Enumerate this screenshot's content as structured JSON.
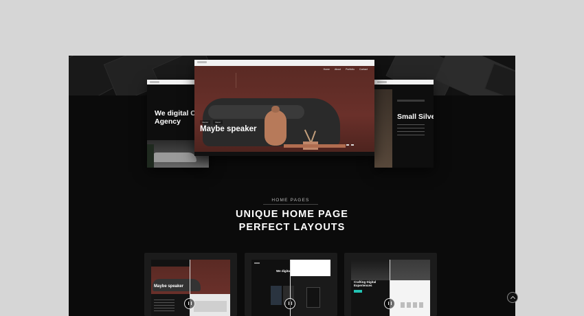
{
  "hero": {
    "left_window": {
      "title": "We digital Creative Agency"
    },
    "main_window": {
      "nav_items": [
        "Home",
        "About",
        "Portfolio",
        "Contact"
      ],
      "categories": [
        "Interior",
        "Decor"
      ],
      "headline": "Maybe speaker"
    },
    "right_window": {
      "title": "Small Silver"
    }
  },
  "section": {
    "tag": "HOME PAGES",
    "title_line1": "UNIQUE HOME PAGE",
    "title_line2": "PERFECT LAYOUTS"
  },
  "cards": [
    {
      "title": "Maybe speaker"
    },
    {
      "title": "We digital Creative Agency"
    },
    {
      "title": "Crafting Digital Experiences"
    }
  ],
  "icons": {
    "scroll_top": "arrow-up-icon",
    "compare": "pause-icon"
  }
}
